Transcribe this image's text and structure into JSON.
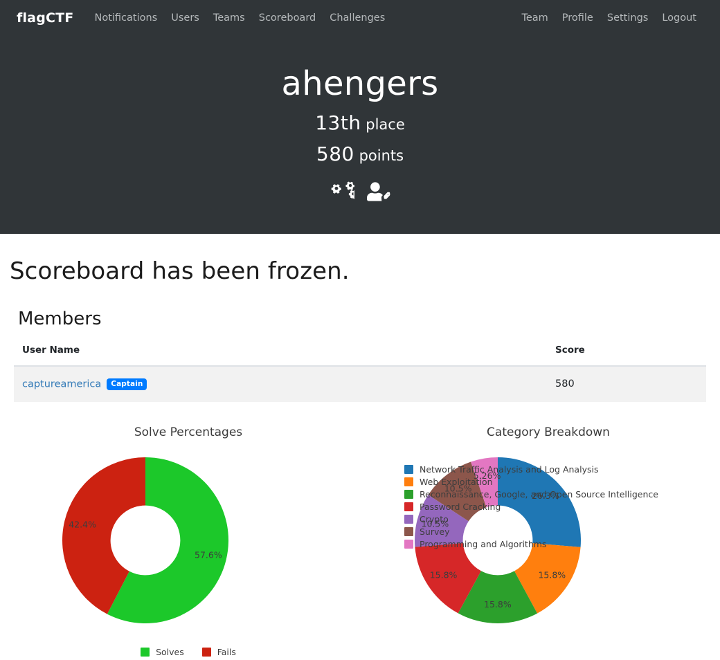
{
  "navbar": {
    "brand": "flagCTF",
    "left_links": [
      {
        "label": "Notifications",
        "name": "nav-notifications"
      },
      {
        "label": "Users",
        "name": "nav-users"
      },
      {
        "label": "Teams",
        "name": "nav-teams"
      },
      {
        "label": "Scoreboard",
        "name": "nav-scoreboard"
      },
      {
        "label": "Challenges",
        "name": "nav-challenges"
      }
    ],
    "right_links": [
      {
        "label": "Team",
        "name": "nav-team"
      },
      {
        "label": "Profile",
        "name": "nav-profile"
      },
      {
        "label": "Settings",
        "name": "nav-settings"
      },
      {
        "label": "Logout",
        "name": "nav-logout"
      }
    ]
  },
  "jumbotron": {
    "team_name": "ahengers",
    "place_value": "13th",
    "place_label": "place",
    "points_value": "580",
    "points_label": "points",
    "icons": [
      "cogs-icon",
      "user-tag-icon"
    ]
  },
  "page": {
    "frozen_notice": "Scoreboard has been frozen.",
    "members_heading": "Members"
  },
  "members_table": {
    "columns": [
      "User Name",
      "Score"
    ],
    "rows": [
      {
        "user": "captureamerica",
        "badge": "Captain",
        "score": "580"
      }
    ]
  },
  "colors": {
    "navbar_bg": "#303538",
    "link_blue": "#337ab7",
    "badge_blue": "#007bff",
    "solve_green": "#1cc82a",
    "fail_red": "#cc2211",
    "cat_blue": "#1f77b4",
    "cat_orange": "#ff7f0e",
    "cat_green": "#2ca02c",
    "cat_red": "#d62728",
    "cat_purple": "#9467bd",
    "cat_brown": "#8c564b",
    "cat_pink": "#e377c2"
  },
  "chart_data": [
    {
      "type": "pie",
      "name": "solve-percentages",
      "title": "Solve Percentages",
      "donut": true,
      "hole_fraction": 0.42,
      "start_angle_deg": 90,
      "direction": "clockwise",
      "labels": [
        "Solves",
        "Fails"
      ],
      "values": [
        57.6,
        42.4
      ],
      "value_labels": [
        "57.6%",
        "42.4%"
      ],
      "colors": [
        "#1cc82a",
        "#cc2211"
      ],
      "legend": {
        "position": "bottom",
        "entries": [
          "Solves",
          "Fails"
        ]
      }
    },
    {
      "type": "pie",
      "name": "category-breakdown",
      "title": "Category Breakdown",
      "donut": true,
      "hole_fraction": 0.42,
      "start_angle_deg": 90,
      "direction": "clockwise",
      "labels": [
        "Network Traffic Analysis and Log Analysis",
        "Web Exploitation",
        "Reconnaissance, Google, and Open Source Intelligence",
        "Password Cracking",
        "Crypto",
        "Survey",
        "Programming and Algorithms"
      ],
      "values": [
        26.3,
        15.8,
        15.8,
        15.8,
        10.5,
        10.5,
        5.26
      ],
      "value_labels": [
        "26.3%",
        "15.8%",
        "15.8%",
        "15.8%",
        "10.5%",
        "10.5%",
        "5.26%"
      ],
      "colors": [
        "#1f77b4",
        "#ff7f0e",
        "#2ca02c",
        "#d62728",
        "#9467bd",
        "#8c564b",
        "#e377c2"
      ],
      "legend": {
        "position": "upper-left-overlay",
        "entries": [
          "Network Traffic Analysis and Log Analysis",
          "Web Exploitation",
          "Reconnaissance, Google, and Open Source Intelligence",
          "Password Cracking",
          "Crypto",
          "Survey",
          "Programming and Algorithms"
        ]
      }
    }
  ]
}
